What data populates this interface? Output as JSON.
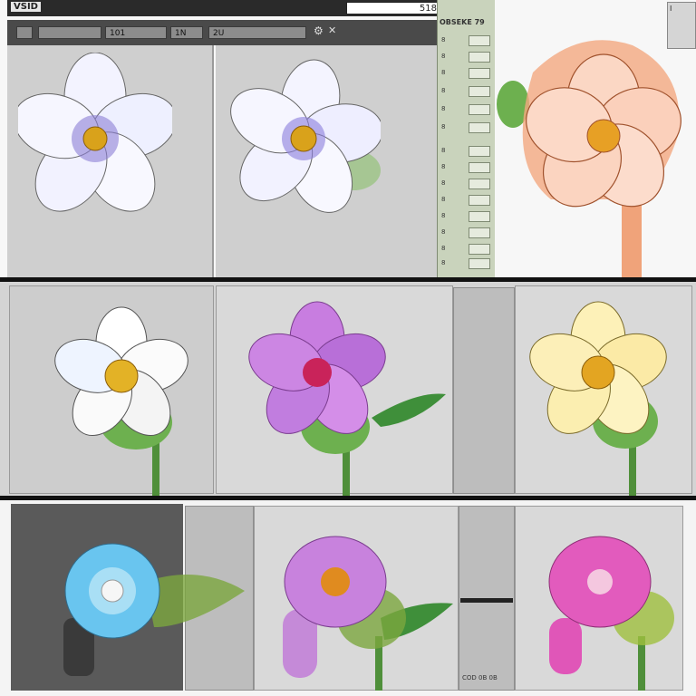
{
  "window": {
    "brand": "VSID",
    "zoom": "518"
  },
  "toolbar": {
    "fields": [
      "",
      "",
      "101",
      "1N",
      "2U"
    ]
  },
  "sidebar": {
    "header": "OBSEKE 79",
    "rows": [
      "8",
      "8",
      "8",
      "8",
      "8",
      "8",
      "8",
      "8",
      "8",
      "8",
      "8",
      "8",
      "8",
      "8"
    ]
  },
  "right_mini": {
    "value": "I"
  },
  "status": {
    "bottom_label": "COD 0B 0B"
  },
  "icons": {
    "gear": "gear-icon",
    "close": "close-icon"
  },
  "colors": {
    "toolbar": "#4a4a4a",
    "sidebar": "#c9d3bc",
    "panel_gray": "#cfcfcf",
    "divider": "#111111"
  }
}
